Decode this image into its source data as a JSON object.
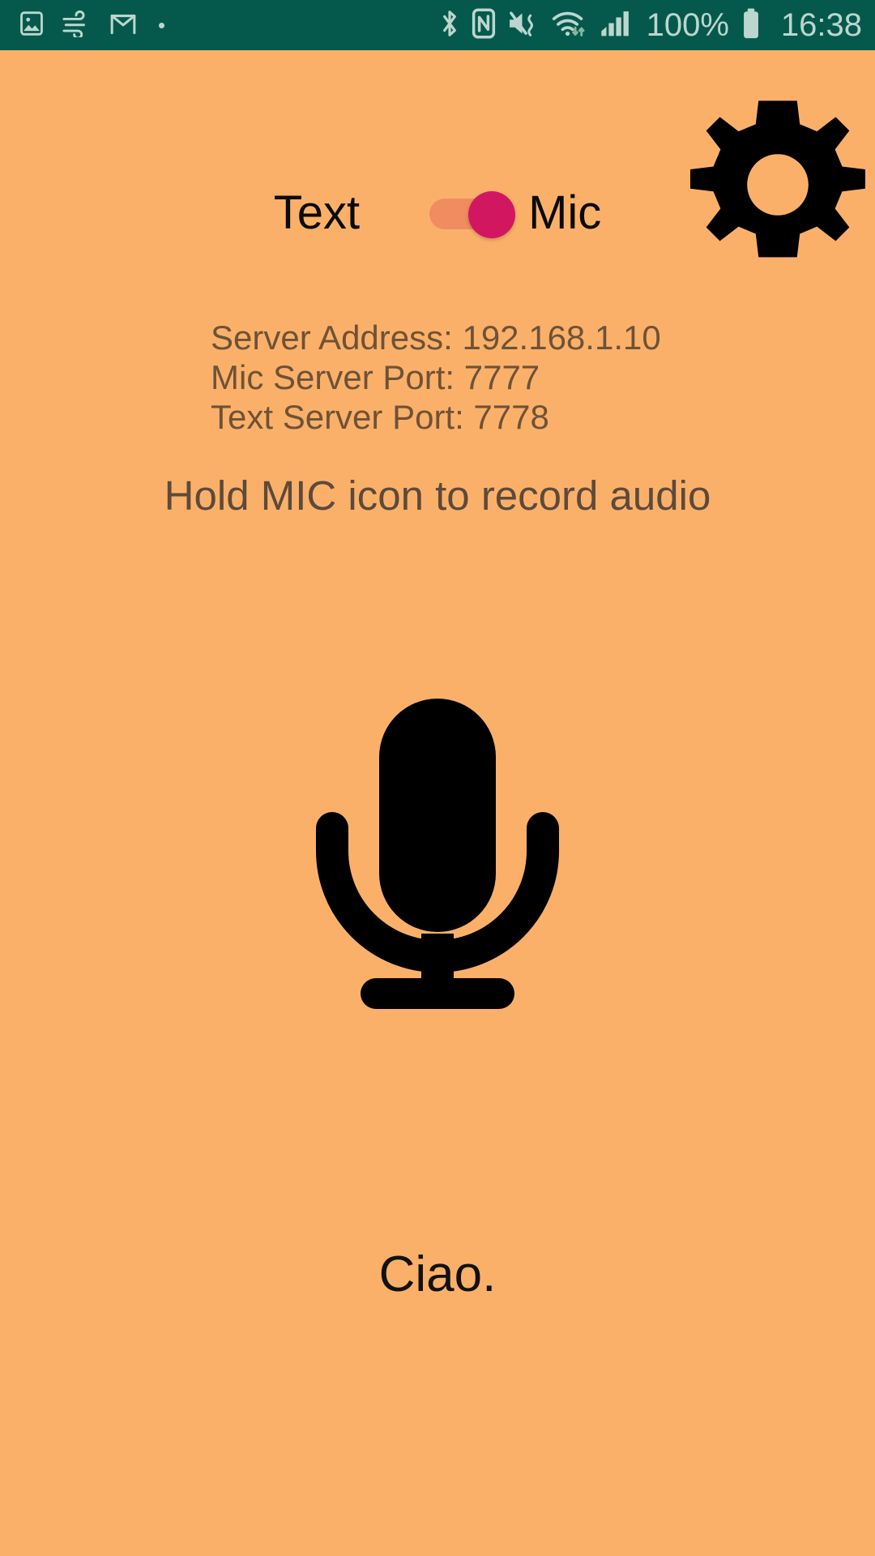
{
  "status_bar": {
    "background_color": "#04594c",
    "icon_color": "#bcd6cf",
    "left_icons": [
      {
        "name": "image-gallery-icon",
        "glyph": "image"
      },
      {
        "name": "wind-air-icon",
        "glyph": "wind"
      },
      {
        "name": "gmail-icon",
        "glyph": "gmail-m"
      },
      {
        "name": "notification-dot-icon",
        "glyph": "dot"
      }
    ],
    "right_icons": [
      {
        "name": "bluetooth-icon",
        "glyph": "bluetooth"
      },
      {
        "name": "nfc-icon",
        "glyph": "nfc"
      },
      {
        "name": "mute-vibrate-icon",
        "glyph": "speaker-mute-vibrate"
      },
      {
        "name": "wifi-icon",
        "glyph": "wifi-data-arrows"
      },
      {
        "name": "cellular-signal-icon",
        "glyph": "signal-bars"
      }
    ],
    "battery_percent": "100%",
    "battery_icon": "battery-full-icon",
    "time": "16:38"
  },
  "header": {
    "settings_icon": "gear-icon"
  },
  "mode_toggle": {
    "left_label": "Text",
    "right_label": "Mic",
    "selected": "Mic",
    "state": "on",
    "track_color": "#f0895f",
    "thumb_color": "#d21761"
  },
  "server_info": {
    "lines": [
      "Server Address: 192.168.1.10",
      "Mic Server Port: 7777",
      "Text Server Port: 7778"
    ],
    "address_label": "Server Address:",
    "address_value": "192.168.1.10",
    "mic_port_label": "Mic Server Port:",
    "mic_port_value": "7777",
    "text_port_label": "Text Server Port:",
    "text_port_value": "7778",
    "text_color": "#6e5236"
  },
  "instruction": {
    "text": "Hold MIC icon to record audio"
  },
  "mic_button": {
    "icon": "microphone-icon",
    "color": "#000000"
  },
  "transcript": {
    "text": "Ciao."
  },
  "theme": {
    "background": "#fbb06a",
    "accent": "#d21761",
    "status_bar": "#04594c"
  }
}
